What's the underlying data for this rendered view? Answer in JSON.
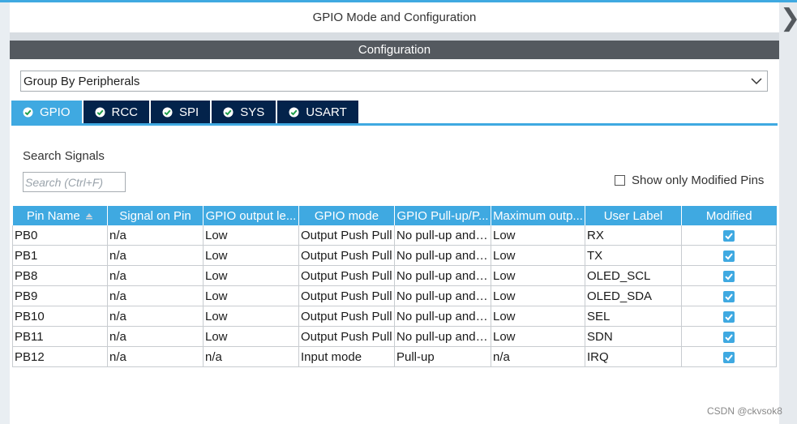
{
  "window": {
    "title": "GPIO Mode and Configuration"
  },
  "config": {
    "header": "Configuration"
  },
  "group": {
    "selected": "Group By Peripherals"
  },
  "tabs": [
    {
      "label": "GPIO",
      "icon": "check-circle-icon",
      "active": true
    },
    {
      "label": "RCC",
      "icon": "check-circle-icon"
    },
    {
      "label": "SPI",
      "icon": "check-circle-icon"
    },
    {
      "label": "SYS",
      "icon": "check-circle-icon"
    },
    {
      "label": "USART",
      "icon": "check-circle-icon"
    }
  ],
  "search": {
    "label": "Search Signals",
    "placeholder": "Search (Ctrl+F)",
    "value": ""
  },
  "filter": {
    "modified_only_label": "Show only Modified Pins",
    "checked": false
  },
  "table": {
    "headers": [
      "Pin Name",
      "Signal on Pin",
      "GPIO output le...",
      "GPIO mode",
      "GPIO Pull-up/P...",
      "Maximum outp...",
      "User Label",
      "Modified"
    ],
    "rows": [
      [
        "PB0",
        "n/a",
        "Low",
        "Output Push Pull",
        "No pull-up and ...",
        "Low",
        "RX",
        true
      ],
      [
        "PB1",
        "n/a",
        "Low",
        "Output Push Pull",
        "No pull-up and ...",
        "Low",
        "TX",
        true
      ],
      [
        "PB8",
        "n/a",
        "Low",
        "Output Push Pull",
        "No pull-up and ...",
        "Low",
        "OLED_SCL",
        true
      ],
      [
        "PB9",
        "n/a",
        "Low",
        "Output Push Pull",
        "No pull-up and ...",
        "Low",
        "OLED_SDA",
        true
      ],
      [
        "PB10",
        "n/a",
        "Low",
        "Output Push Pull",
        "No pull-up and ...",
        "Low",
        "SEL",
        true
      ],
      [
        "PB11",
        "n/a",
        "Low",
        "Output Push Pull",
        "No pull-up and ...",
        "Low",
        "SDN",
        true
      ],
      [
        "PB12",
        "n/a",
        "n/a",
        "Input mode",
        "Pull-up",
        "n/a",
        "IRQ",
        true
      ]
    ]
  },
  "colors": {
    "accent": "#3fa9e1",
    "tab_dark": "#03234b",
    "header_gray": "#54595f"
  },
  "watermark": "CSDN @ckvsok8"
}
